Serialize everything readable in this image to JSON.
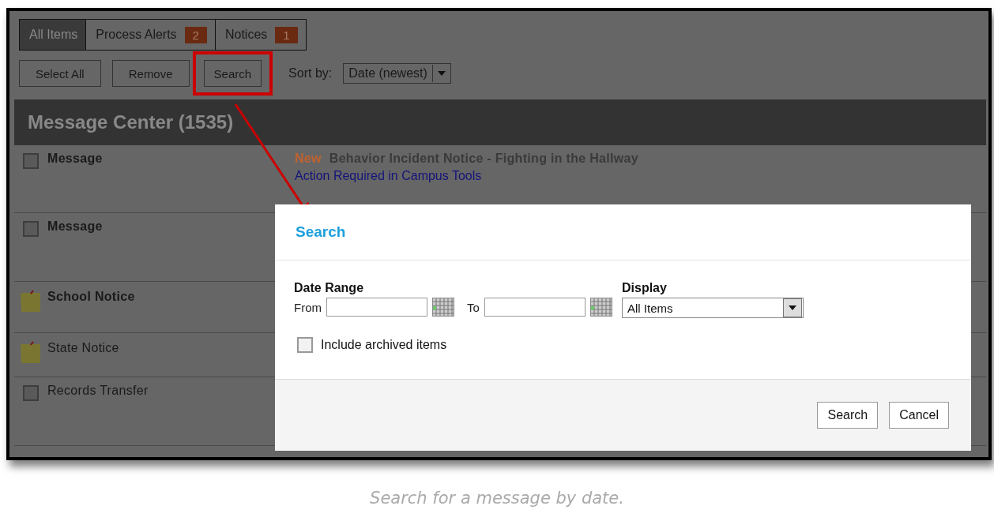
{
  "tabs": [
    {
      "label": "All Items",
      "selected": true
    },
    {
      "label": "Process Alerts",
      "count": "2",
      "selected": false
    },
    {
      "label": "Notices",
      "count": "1",
      "selected": false
    }
  ],
  "toolbar": {
    "buttons": [
      {
        "label": "Select All",
        "highlighted": false
      },
      {
        "label": "Remove",
        "highlighted": false
      },
      {
        "label": "Search",
        "highlighted": true
      }
    ],
    "sort_label": "Sort by:",
    "sort_value": "Date (newest)"
  },
  "header": {
    "title": "Message Center (1535)"
  },
  "rows": [
    {
      "kind": "checkbox",
      "label": "Message",
      "bold": true,
      "checked": false,
      "badge": "New",
      "subject": "Behavior Incident Notice - Fighting in the Hallway",
      "link": "Action Required in Campus Tools"
    },
    {
      "kind": "checkbox",
      "label": "Message",
      "bold": true,
      "checked": false
    },
    {
      "kind": "notice",
      "label": "School Notice",
      "bold": true
    },
    {
      "kind": "notice",
      "label": "State Notice",
      "bold": false
    },
    {
      "kind": "checkbox",
      "label": "Records Transfer",
      "bold": false,
      "checked": false
    }
  ],
  "dialog": {
    "title": "Search",
    "date_range_label": "Date Range",
    "from_label": "From",
    "to_label": "To",
    "display_label": "Display",
    "display_value": "All Items",
    "archived": {
      "label": "Include archived items",
      "checked": false
    },
    "buttons": [
      "Search",
      "Cancel"
    ]
  },
  "caption": "Search for a message by date."
}
